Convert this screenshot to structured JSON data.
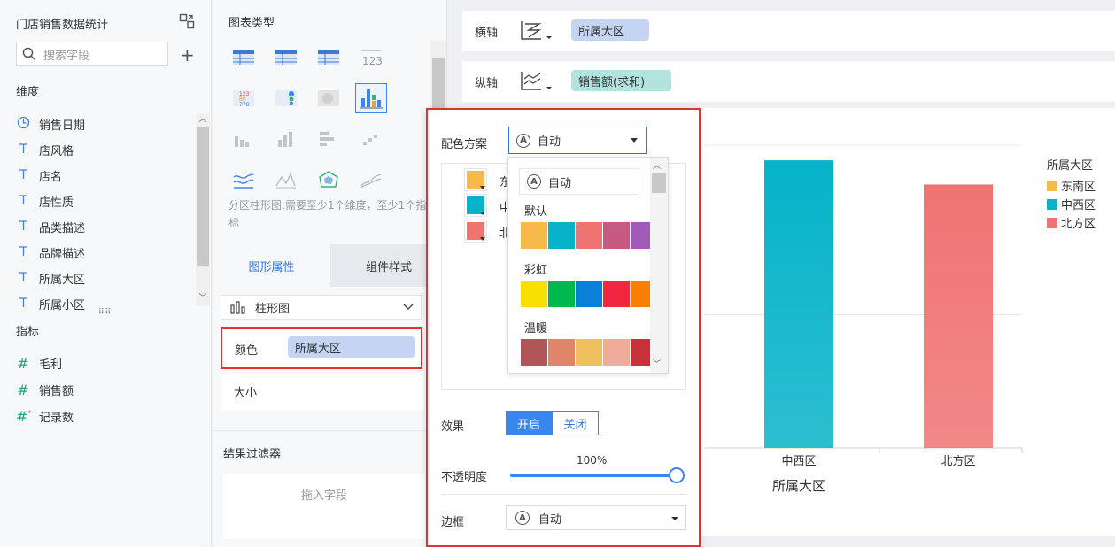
{
  "left": {
    "title": "门店销售数据统计",
    "search_placeholder": "搜索字段",
    "dim_header": "维度",
    "dimensions": [
      {
        "icon": "clock-icon",
        "label": "销售日期"
      },
      {
        "icon": "text-type-icon",
        "label": "店风格"
      },
      {
        "icon": "text-type-icon",
        "label": "店名"
      },
      {
        "icon": "text-type-icon",
        "label": "店性质"
      },
      {
        "icon": "text-type-icon",
        "label": "品类描述"
      },
      {
        "icon": "text-type-icon",
        "label": "品牌描述"
      },
      {
        "icon": "text-type-icon",
        "label": "所属大区"
      },
      {
        "icon": "text-type-icon",
        "label": "所属小区"
      }
    ],
    "measure_header": "指标",
    "measures": [
      {
        "icon": "hash-icon",
        "label": "毛利"
      },
      {
        "icon": "hash-icon",
        "label": "销售额"
      },
      {
        "icon": "hash-star-icon",
        "label": "记录数"
      }
    ]
  },
  "mid": {
    "chart_type_header": "图表类型",
    "hint": "分区柱形图:需要至少1个维度，至少1个指标",
    "tab_shape": "图形属性",
    "tab_style": "组件样式",
    "chart_kind": "柱形图",
    "color_label": "颜色",
    "color_field": "所属大区",
    "size_label": "大小",
    "filter_header": "结果过滤器",
    "filter_drop": "拖入字段"
  },
  "axes": {
    "x_label": "横轴",
    "x_field": "所属大区",
    "y_label": "纵轴",
    "y_field": "销售额(求和)"
  },
  "chart_data": {
    "type": "bar",
    "categories": [
      "东南区",
      "中西区",
      "北方区"
    ],
    "visible_categories": [
      "中西区",
      "北方区"
    ],
    "values": [
      null,
      0.95,
      0.87
    ],
    "value_unit": "relative height (no y-axis visible)",
    "xlabel": "所属大区",
    "legend_title": "所属大区",
    "legend_position": "right",
    "colors": [
      "#f6b94c",
      "#06b3c9",
      "#f07373"
    ],
    "grid": true
  },
  "legend": {
    "title": "所属大区",
    "items": [
      {
        "label": "东南区",
        "color": "#f6b94c"
      },
      {
        "label": "中西区",
        "color": "#06b3c9"
      },
      {
        "label": "北方区",
        "color": "#f07373"
      }
    ]
  },
  "popup": {
    "scheme_label": "配色方案",
    "scheme_value": "自动",
    "scheme_options": {
      "auto": "自动",
      "groups": [
        {
          "name": "默认",
          "colors": [
            "#f6b94c",
            "#06b3c9",
            "#f07373",
            "#c75a80",
            "#9f5bb5"
          ]
        },
        {
          "name": "彩虹",
          "colors": [
            "#f8e100",
            "#00b94c",
            "#0c7fd8",
            "#f2273f",
            "#f78000"
          ]
        },
        {
          "name": "温暖",
          "colors": [
            "#b15656",
            "#e0846a",
            "#f0c060",
            "#f2ab98",
            "#c8303a"
          ]
        }
      ]
    },
    "mapping_items": [
      {
        "label": "东",
        "color": "#f6b94c"
      },
      {
        "label": "中",
        "color": "#06b3c9"
      },
      {
        "label": "北",
        "color": "#f07373"
      }
    ],
    "effect_label": "效果",
    "effect_on": "开启",
    "effect_off": "关闭",
    "opacity_label": "不透明度",
    "opacity_value": "100%",
    "opacity_fraction": 1.0,
    "border_label": "边框",
    "border_value": "自动"
  }
}
